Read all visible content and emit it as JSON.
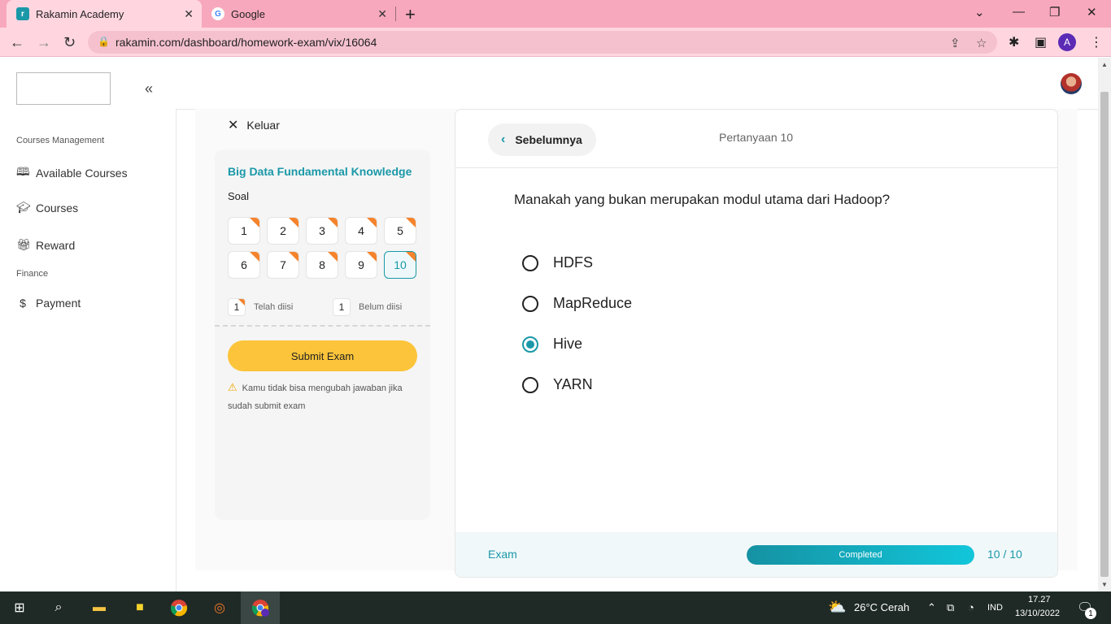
{
  "browser": {
    "tabs": [
      {
        "title": "Rakamin Academy",
        "active": true
      },
      {
        "title": "Google",
        "active": false
      }
    ],
    "url": "rakamin.com/dashboard/homework-exam/vix/16064",
    "profile_initial": "A",
    "colors": {
      "tabbar": "#f8a8bd",
      "toolbar": "#ffd6e0"
    }
  },
  "sidebar": {
    "sections": [
      {
        "label": "Courses Management"
      },
      {
        "label": "Finance"
      }
    ],
    "items": [
      {
        "label": "Available Courses",
        "icon": "book-icon"
      },
      {
        "label": "Courses",
        "icon": "graduation-cap-icon"
      },
      {
        "label": "Reward",
        "icon": "gift-icon"
      },
      {
        "label": "Payment",
        "icon": "dollar-icon"
      }
    ]
  },
  "exam_panel": {
    "exit_label": "Keluar",
    "course_title": "Big Data Fundamental Knowledge",
    "soal_label": "Soal",
    "questions": [
      "1",
      "2",
      "3",
      "4",
      "5",
      "6",
      "7",
      "8",
      "9",
      "10"
    ],
    "current_question": "10",
    "legend": {
      "answered_count": "1",
      "answered_label": "Telah diisi",
      "unanswered_count": "1",
      "unanswered_label": "Belum diisi"
    },
    "submit_label": "Submit Exam",
    "warning": "Kamu tidak bisa mengubah jawaban jika sudah submit exam"
  },
  "question_card": {
    "prev_label": "Sebelumnya",
    "question_number": "Pertanyaan 10",
    "question_text": "Manakah yang bukan merupakan modul utama dari Hadoop?",
    "options": [
      {
        "label": "HDFS",
        "selected": false
      },
      {
        "label": "MapReduce",
        "selected": false
      },
      {
        "label": "Hive",
        "selected": true
      },
      {
        "label": "YARN",
        "selected": false
      }
    ],
    "footer": {
      "label": "Exam",
      "progress_text": "Completed",
      "progress_fraction": 1.0,
      "count": "10 / 10"
    },
    "accent": "#1a98a8"
  },
  "taskbar": {
    "weather": "26°C  Cerah",
    "lang": "IND",
    "time": "17.27",
    "date": "13/10/2022",
    "notification_count": "1"
  }
}
